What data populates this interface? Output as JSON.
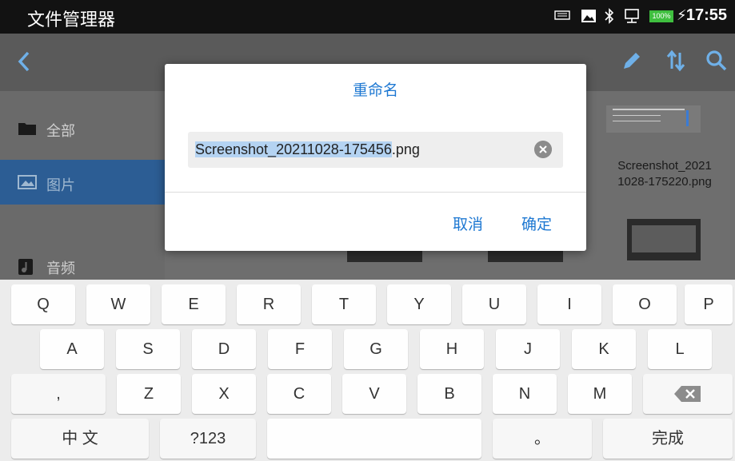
{
  "status_bar": {
    "app_title": "文件管理器",
    "battery": "100%",
    "time": "17:55"
  },
  "sidebar": {
    "items": [
      {
        "label": "全部"
      },
      {
        "label": "图片"
      },
      {
        "label": "音频"
      }
    ]
  },
  "content": {
    "file_name_line1": "Screenshot_2021",
    "file_name_line2": "1028-175220.png"
  },
  "dialog": {
    "title": "重命名",
    "field_selected": "Screenshot_20211028-175456",
    "field_extension": ".png",
    "cancel_label": "取消",
    "confirm_label": "确定"
  },
  "keyboard": {
    "row1": [
      "Q",
      "W",
      "E",
      "R",
      "T",
      "Y",
      "U",
      "I",
      "O",
      "P"
    ],
    "row2": [
      "A",
      "S",
      "D",
      "F",
      "G",
      "H",
      "J",
      "K",
      "L"
    ],
    "row3": [
      ",",
      "Z",
      "X",
      "C",
      "V",
      "B",
      "N",
      "M"
    ],
    "lang_label": "中 文",
    "sym_label": "?123",
    "period_label": "。",
    "done_label": "完成"
  }
}
